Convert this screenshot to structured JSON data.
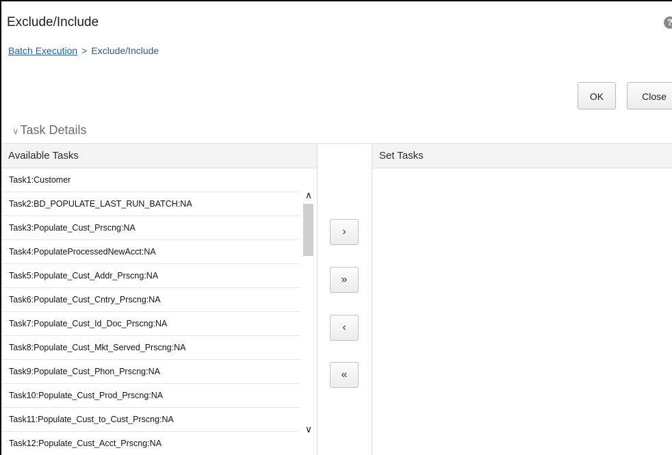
{
  "page": {
    "title": "Exclude/Include",
    "help_icon": "?"
  },
  "breadcrumb": {
    "link": "Batch Execution",
    "separator": ">",
    "current": "Exclude/Include"
  },
  "actions": {
    "ok_label": "OK",
    "close_label": "Close"
  },
  "section": {
    "chevron": "∨",
    "title": "Task Details"
  },
  "available": {
    "header": "Available Tasks",
    "tasks": [
      "Task1:Customer",
      "Task2:BD_POPULATE_LAST_RUN_BATCH:NA",
      "Task3:Populate_Cust_Prscng:NA",
      "Task4:PopulateProcessedNewAcct:NA",
      "Task5:Populate_Cust_Addr_Prscng:NA",
      "Task6:Populate_Cust_Cntry_Prscng:NA",
      "Task7:Populate_Cust_Id_Doc_Prscng:NA",
      "Task8:Populate_Cust_Mkt_Served_Prscng:NA",
      "Task9:Populate_Cust_Phon_Prscng:NA",
      "Task10:Populate_Cust_Prod_Prscng:NA",
      "Task11:Populate_Cust_to_Cust_Prscng:NA",
      "Task12:Populate_Cust_Acct_Prscng:NA"
    ]
  },
  "set": {
    "header": "Set Tasks",
    "tasks": []
  },
  "shuttle": {
    "move_one": "›",
    "move_all": "»",
    "remove_one": "‹",
    "remove_all": "«"
  },
  "scrollbar": {
    "up": "∧",
    "down": "∨"
  }
}
